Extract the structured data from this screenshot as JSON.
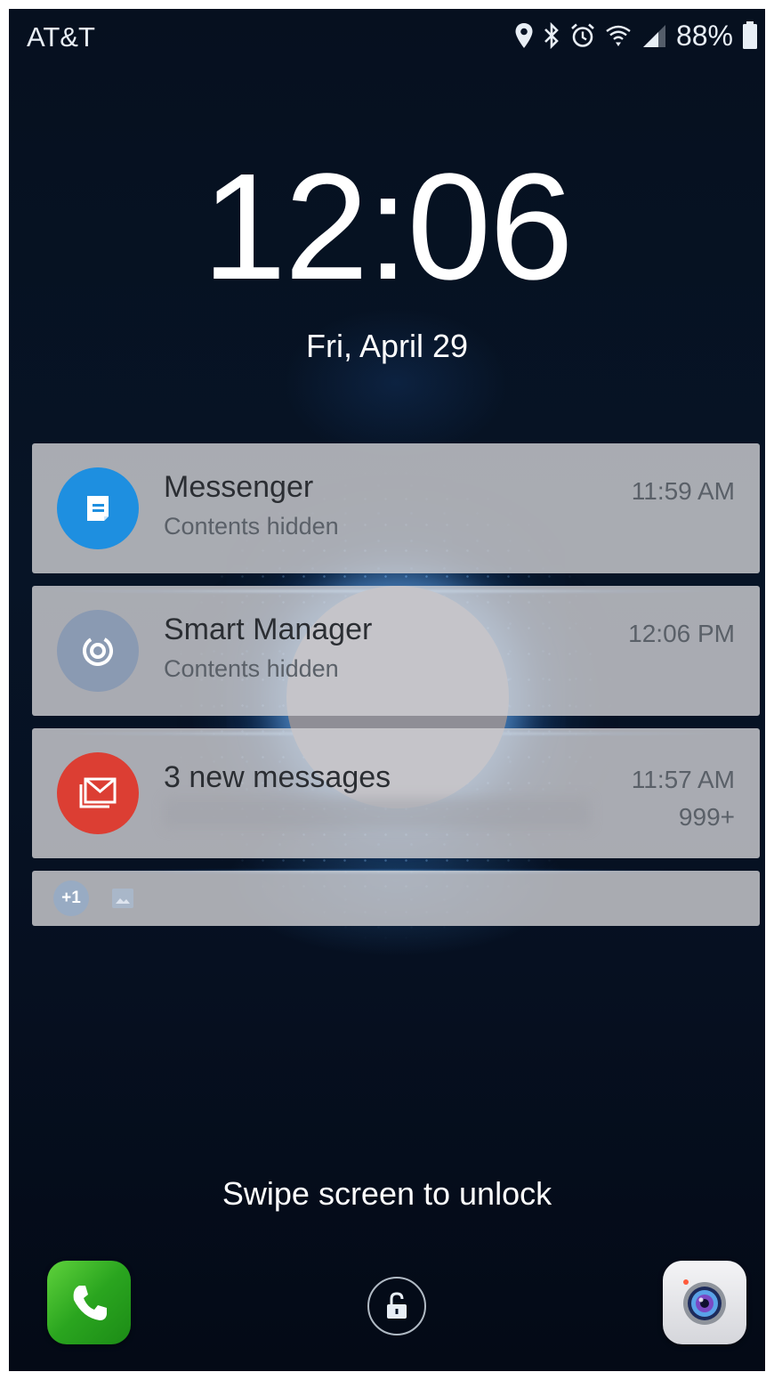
{
  "status_bar": {
    "carrier": "AT&T",
    "battery_percent": "88%",
    "icons": [
      "location-icon",
      "bluetooth-icon",
      "alarm-icon",
      "wifi-icon",
      "signal-icon",
      "battery-icon"
    ]
  },
  "lockscreen": {
    "time": "12:06",
    "date": "Fri, April 29",
    "unlock_hint": "Swipe screen to unlock"
  },
  "notifications": [
    {
      "app": "Messenger",
      "subtitle": "Contents hidden",
      "time": "11:59 AM",
      "icon": "messenger-icon",
      "color": "#1e8fe0"
    },
    {
      "app": "Smart Manager",
      "subtitle": "Contents hidden",
      "time": "12:06 PM",
      "icon": "smart-manager-icon",
      "color": "#8a9ab2"
    },
    {
      "app": "3 new messages",
      "time": "11:57 AM",
      "count": "999+",
      "icon": "gmail-icon",
      "color": "#dc3e33"
    }
  ],
  "more_notifications": {
    "badge": "+1",
    "icon": "image-icon"
  },
  "shortcuts": {
    "left": "phone-icon",
    "center": "unlock-icon",
    "right": "camera-icon"
  }
}
